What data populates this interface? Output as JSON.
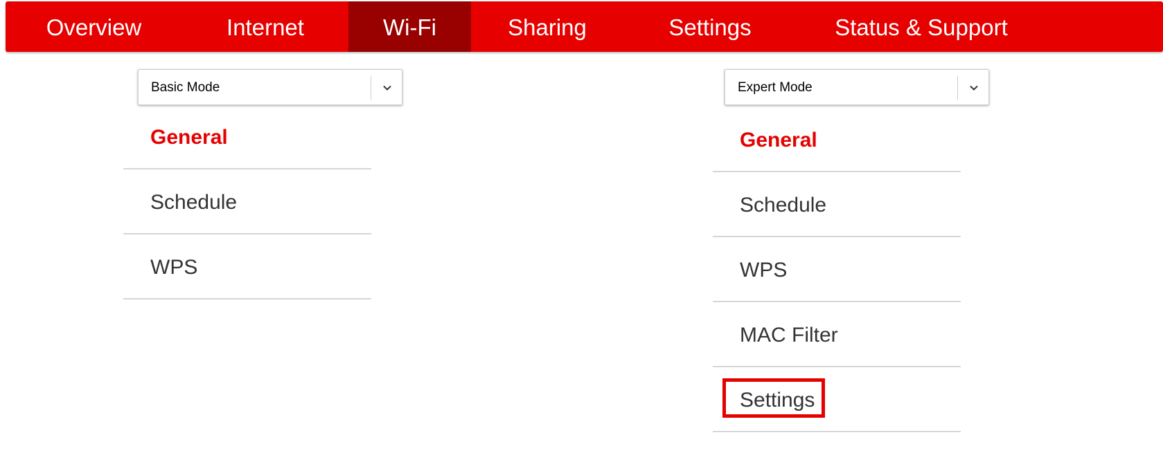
{
  "nav": {
    "items": [
      {
        "label": "Overview"
      },
      {
        "label": "Internet"
      },
      {
        "label": "Wi-Fi"
      },
      {
        "label": "Sharing"
      },
      {
        "label": "Settings"
      },
      {
        "label": "Status & Support"
      }
    ],
    "active": "Wi-Fi"
  },
  "basic_panel": {
    "mode_select": {
      "value": "Basic Mode"
    },
    "menu": [
      {
        "label": "General"
      },
      {
        "label": "Schedule"
      },
      {
        "label": "WPS"
      }
    ],
    "active": "General"
  },
  "expert_panel": {
    "mode_select": {
      "value": "Expert Mode"
    },
    "menu": [
      {
        "label": "General"
      },
      {
        "label": "Schedule"
      },
      {
        "label": "WPS"
      },
      {
        "label": "MAC Filter"
      },
      {
        "label": "Settings"
      }
    ],
    "active": "General",
    "highlighted": "Settings"
  },
  "icons": {
    "select_arrow": "chevron-down-icon"
  },
  "colors": {
    "brand_red": "#e60000",
    "active_tab": "#990000",
    "text": "#333333",
    "divider": "#d6d6d6"
  }
}
